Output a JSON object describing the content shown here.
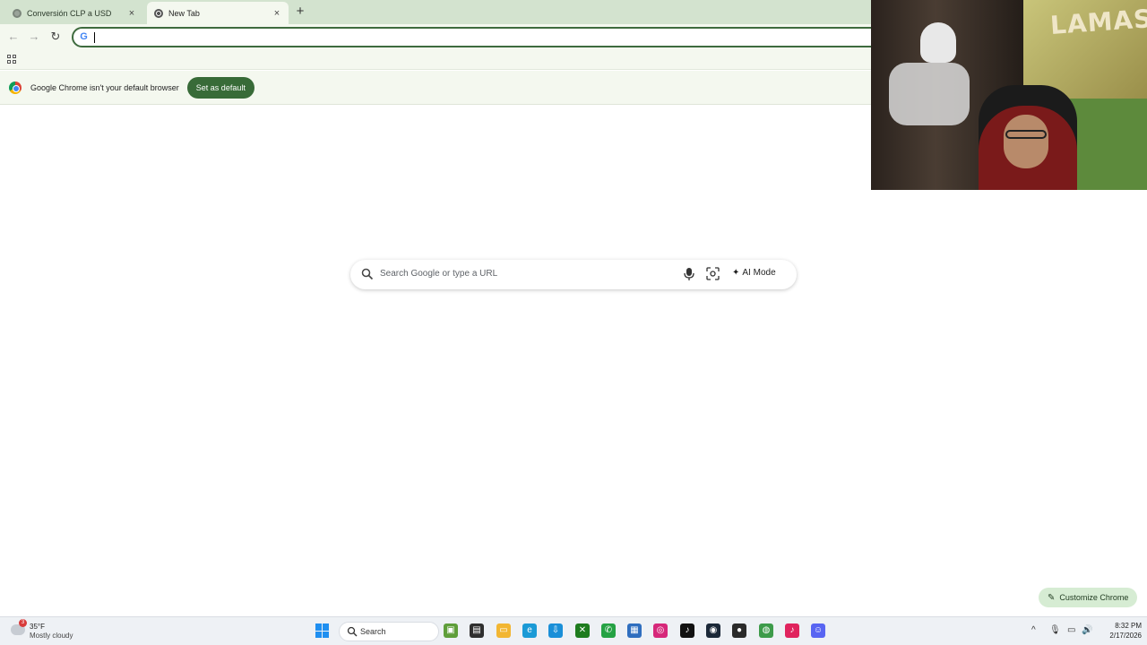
{
  "tabs": [
    {
      "title": "Conversión CLP a USD",
      "close": "×"
    },
    {
      "title": "New Tab",
      "close": "×"
    }
  ],
  "new_tab_symbol": "+",
  "toolbar": {
    "back": "←",
    "forward": "→",
    "reload": "↻",
    "omnibox_value": "",
    "google_g": "G"
  },
  "infobar": {
    "message": "Google Chrome isn't your default browser",
    "button": "Set as default"
  },
  "webcam": {
    "graffiti": "LAMAS"
  },
  "ntp": {
    "search_placeholder": "Search Google or type a URL",
    "ai_mode": "AI Mode",
    "ai_mode_icon": "✦"
  },
  "customize": {
    "label": "Customize Chrome",
    "icon": "✎"
  },
  "taskbar": {
    "weather_temp": "35°F",
    "weather_condition": "Mostly cloudy",
    "weather_badge": "3",
    "search_label": "Search",
    "time": "8:32 PM",
    "date": "2/17/2026",
    "apps": [
      {
        "name": "app-wsl",
        "color": "#5f9e3a",
        "glyph": "▣"
      },
      {
        "name": "app-notepad",
        "color": "#2f2f2f",
        "glyph": "▤"
      },
      {
        "name": "app-files",
        "color": "#f2b632",
        "glyph": "▭"
      },
      {
        "name": "app-edge",
        "color": "#1b9ad6",
        "glyph": "e"
      },
      {
        "name": "app-store-download",
        "color": "#1a8fd8",
        "glyph": "⇩"
      },
      {
        "name": "app-xbox",
        "color": "#1e7c1e",
        "glyph": "✕"
      },
      {
        "name": "app-whatsapp",
        "color": "#25a244",
        "glyph": "✆"
      },
      {
        "name": "app-store",
        "color": "#2f6ebf",
        "glyph": "▦"
      },
      {
        "name": "app-instagram",
        "color": "#d6287a",
        "glyph": "◎"
      },
      {
        "name": "app-tiktok",
        "color": "#111111",
        "glyph": "♪"
      },
      {
        "name": "app-steam",
        "color": "#1b2838",
        "glyph": "◉"
      },
      {
        "name": "app-obs",
        "color": "#2a2a2a",
        "glyph": "●"
      },
      {
        "name": "app-chrome",
        "color": "#3d9b4a",
        "glyph": "◍"
      },
      {
        "name": "app-tiktok-live",
        "color": "#e0245e",
        "glyph": "♪"
      },
      {
        "name": "app-discord",
        "color": "#5865f2",
        "glyph": "☺"
      }
    ],
    "tray": {
      "chevron": "^",
      "mic": "🎙",
      "network": "▭",
      "volume": "🔊"
    }
  },
  "colors": {
    "tabstrip": "#d3e3cf",
    "toolbar": "#f4f8ef",
    "accent": "#386b38"
  }
}
